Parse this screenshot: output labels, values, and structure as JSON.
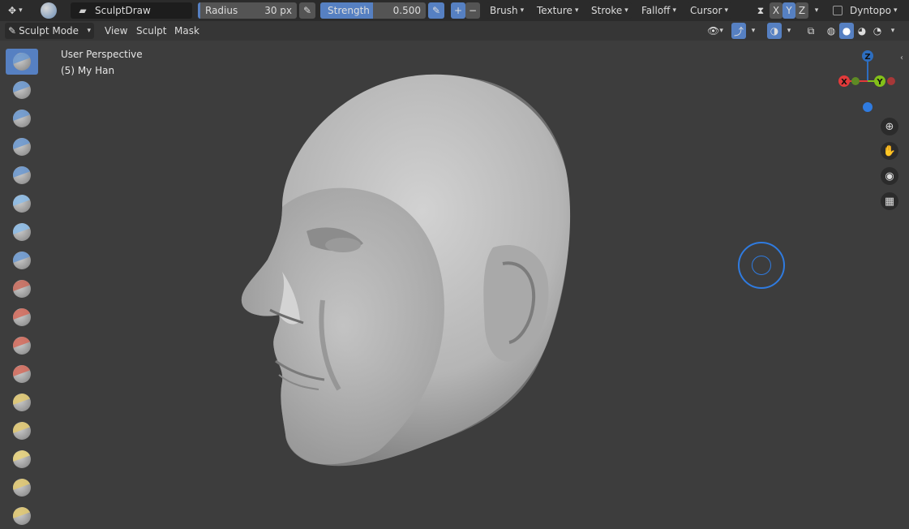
{
  "topbar": {
    "brush_name": "SculptDraw",
    "radius": {
      "label": "Radius",
      "value": "30 px"
    },
    "strength": {
      "label": "Strength",
      "value": "0.500",
      "fill": 0.5
    },
    "menus": [
      "Brush",
      "Texture",
      "Stroke",
      "Falloff",
      "Cursor"
    ],
    "axes": [
      "X",
      "Y",
      "Z"
    ],
    "dyntopo": "Dyntopo"
  },
  "modebar": {
    "mode": "Sculpt Mode",
    "menus": [
      "View",
      "Sculpt",
      "Mask"
    ]
  },
  "viewport": {
    "perspective": "User Perspective",
    "object": "(5) My Han"
  },
  "gizmo": {
    "x": "X",
    "y": "Y",
    "z": "Z"
  },
  "colors": {
    "accent": "#5680c2",
    "x_axis": "#e23a3a",
    "y_axis": "#83c019",
    "z_axis": "#2d6ec0",
    "brush_cursor": "#2f7be0"
  },
  "tools": [
    "draw",
    "draw-sharp",
    "clay",
    "clay-strips",
    "layer",
    "inflate",
    "blob",
    "crease",
    "smooth",
    "flatten",
    "fill",
    "scrape",
    "pinch",
    "grab",
    "snake-hook",
    "thumb",
    "pose"
  ]
}
